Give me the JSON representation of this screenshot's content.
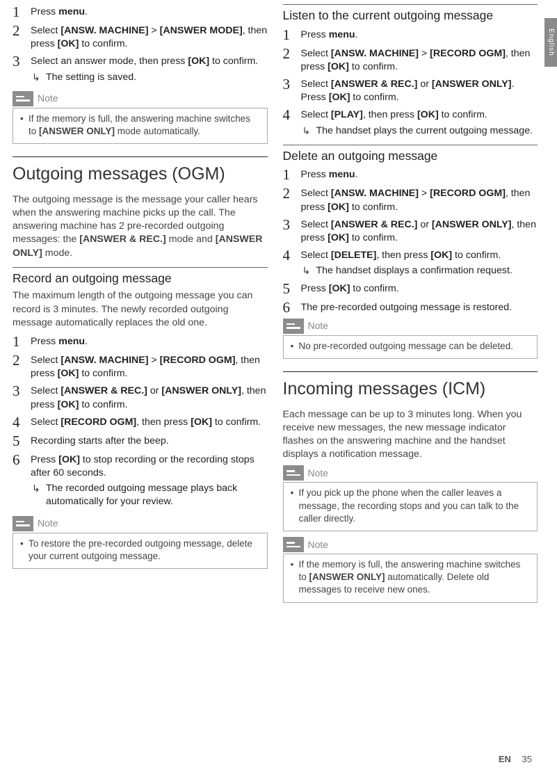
{
  "lang_tab": "English",
  "footer": {
    "lang": "EN",
    "page": "35"
  },
  "left": {
    "steps_top": [
      {
        "n": "1",
        "parts": [
          "Press ",
          "menu",
          "."
        ]
      },
      {
        "n": "2",
        "parts": [
          "Select ",
          "[ANSW. MACHINE]",
          " > ",
          "[ANSWER MODE]",
          ", then press ",
          "[OK]",
          " to confirm."
        ]
      },
      {
        "n": "3",
        "parts": [
          "Select an answer mode, then press ",
          "[OK]",
          " to confirm."
        ],
        "result": "The setting is saved."
      }
    ],
    "note1_label": "Note",
    "note1_text_pre": "If the memory is full, the answering machine switches to ",
    "note1_bold": "[ANSWER ONLY]",
    "note1_text_post": " mode automatically.",
    "ogm_title": "Outgoing messages (OGM)",
    "ogm_intro_pre": "The outgoing message is the message your caller hears when the answering machine picks up the call. The answering machine has 2 pre-recorded outgoing messages: the ",
    "ogm_intro_b1": "[ANSWER & REC.]",
    "ogm_intro_mid": " mode and ",
    "ogm_intro_b2": "[ANSWER ONLY]",
    "ogm_intro_post": " mode.",
    "record_title": "Record an outgoing message",
    "record_intro": "The maximum length of the outgoing message you can record is 3 minutes. The newly recorded outgoing message automatically replaces the old one.",
    "record_steps": [
      {
        "n": "1",
        "html": "Press <b>menu</b>."
      },
      {
        "n": "2",
        "html": "Select <b>[ANSW. MACHINE]</b> > <b>[RECORD OGM]</b>, then press <b>[OK]</b> to confirm."
      },
      {
        "n": "3",
        "html": "Select <b>[ANSWER & REC.]</b> or <b>[ANSWER ONLY]</b>, then press <b>[OK]</b> to confirm."
      },
      {
        "n": "4",
        "html": "Select <b>[RECORD OGM]</b>, then press <b>[OK]</b> to confirm."
      },
      {
        "n": "5",
        "html": "Recording starts after the beep."
      },
      {
        "n": "6",
        "html": "Press <b>[OK]</b> to stop recording or the recording stops after 60 seconds.",
        "result": "The recorded outgoing message plays back automatically for your review."
      }
    ],
    "note2_label": "Note",
    "note2_text": "To restore the pre-recorded outgoing message, delete your current outgoing message."
  },
  "right": {
    "listen_title": "Listen to the current outgoing message",
    "listen_steps": [
      {
        "n": "1",
        "html": "Press <b>menu</b>."
      },
      {
        "n": "2",
        "html": "Select <b>[ANSW. MACHINE]</b> > <b>[RECORD OGM]</b>, then press <b>[OK]</b> to confirm."
      },
      {
        "n": "3",
        "html": "Select <b>[ANSWER & REC.]</b> or <b>[ANSWER ONLY]</b>. Press <b>[OK]</b> to confirm."
      },
      {
        "n": "4",
        "html": "Select <b>[PLAY]</b>, then press <b>[OK]</b> to confirm.",
        "result": "The handset plays the current outgoing message."
      }
    ],
    "delete_title": "Delete an outgoing message",
    "delete_steps": [
      {
        "n": "1",
        "html": "Press <b>menu</b>."
      },
      {
        "n": "2",
        "html": "Select <b>[ANSW. MACHINE]</b> > <b>[RECORD OGM]</b>, then press <b>[OK]</b> to confirm."
      },
      {
        "n": "3",
        "html": "Select <b>[ANSWER & REC.]</b> or <b>[ANSWER ONLY]</b>, then press <b>[OK]</b> to confirm."
      },
      {
        "n": "4",
        "html": "Select <b>[DELETE]</b>, then press <b>[OK]</b> to confirm.",
        "result": "The handset displays a confirmation request."
      },
      {
        "n": "5",
        "html": "Press <b>[OK]</b> to confirm."
      },
      {
        "n": "6",
        "html": "The pre-recorded outgoing message is restored."
      }
    ],
    "note3_label": "Note",
    "note3_text": "No pre-recorded outgoing message can be deleted.",
    "icm_title": "Incoming messages (ICM)",
    "icm_intro": "Each message can be up to 3 minutes long. When you receive new messages, the new message indicator flashes on the answering machine and the handset displays a notification message.",
    "note4_label": "Note",
    "note4_text": "If you pick up the phone when the caller leaves a message, the recording stops and you can talk to the caller directly.",
    "note5_label": "Note",
    "note5_pre": "If the memory is full, the answering machine switches to ",
    "note5_bold": "[ANSWER ONLY]",
    "note5_post": " automatically. Delete old messages to receive new ones."
  }
}
